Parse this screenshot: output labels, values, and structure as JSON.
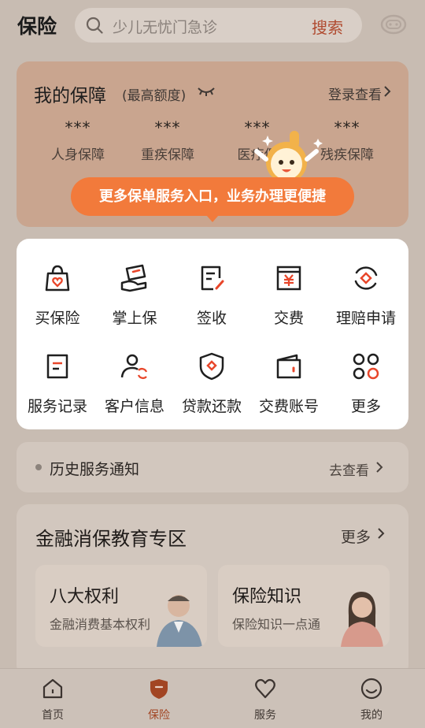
{
  "header": {
    "title": "保险",
    "search_placeholder": "少儿无忧门急诊",
    "search_button": "搜索"
  },
  "protection": {
    "title": "我的保障",
    "subtitle": "(最高额度)",
    "login_link": "登录查看",
    "items": [
      {
        "value": "***",
        "label": "人身保障"
      },
      {
        "value": "***",
        "label": "重疾保障"
      },
      {
        "value": "***",
        "label": "医疗保"
      },
      {
        "value": "***",
        "label": "残疾保障"
      }
    ]
  },
  "tooltip": {
    "text": "更多保单服务入口，业务办理更便捷"
  },
  "services": [
    {
      "label": "买保险",
      "icon": "shopping-bag-heart-icon"
    },
    {
      "label": "掌上保",
      "icon": "hand-card-icon"
    },
    {
      "label": "签收",
      "icon": "sign-doc-icon"
    },
    {
      "label": "交费",
      "icon": "pay-yuan-icon"
    },
    {
      "label": "理赔申请",
      "icon": "claim-cycle-icon"
    },
    {
      "label": "服务记录",
      "icon": "record-doc-icon"
    },
    {
      "label": "客户信息",
      "icon": "customer-refresh-icon"
    },
    {
      "label": "贷款还款",
      "icon": "loan-shield-icon"
    },
    {
      "label": "交费账号",
      "icon": "wallet-icon"
    },
    {
      "label": "更多",
      "icon": "more-grid-icon"
    }
  ],
  "notice": {
    "text": "历史服务通知",
    "link": "去查看"
  },
  "education": {
    "title": "金融消保教育专区",
    "more": "更多",
    "cards": [
      {
        "title": "八大权利",
        "subtitle": "金融消费基本权利"
      },
      {
        "title": "保险知识",
        "subtitle": "保险知识一点通"
      }
    ]
  },
  "tabs": [
    {
      "label": "首页",
      "icon": "home-icon"
    },
    {
      "label": "保险",
      "icon": "shield-icon",
      "active": true
    },
    {
      "label": "服务",
      "icon": "heart-icon"
    },
    {
      "label": "我的",
      "icon": "smile-icon"
    }
  ],
  "colors": {
    "accent": "#f27a3b",
    "brand_red": "#e8462a",
    "overlay_bg": "#c8bcb2"
  }
}
